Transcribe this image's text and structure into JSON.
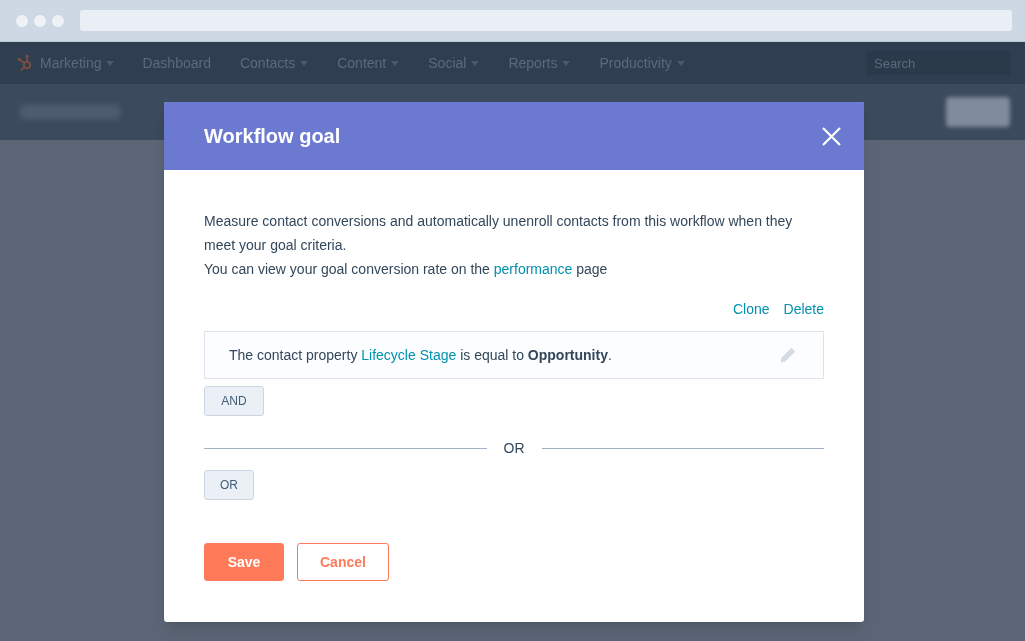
{
  "nav": {
    "app_menu": {
      "label": "Marketing",
      "has_menu": true
    },
    "items": [
      {
        "label": "Dashboard",
        "has_menu": false
      },
      {
        "label": "Contacts",
        "has_menu": true
      },
      {
        "label": "Content",
        "has_menu": true
      },
      {
        "label": "Social",
        "has_menu": true
      },
      {
        "label": "Reports",
        "has_menu": true
      },
      {
        "label": "Productivity",
        "has_menu": true
      }
    ],
    "search": {
      "placeholder": "Search"
    }
  },
  "modal": {
    "title": "Workflow goal",
    "description": "Measure contact conversions and automatically unenroll contacts from this workflow when they meet your goal criteria.",
    "note": {
      "before": "You can view your goal conversion rate on the",
      "link": "performance",
      "after": "page"
    },
    "actions": [
      "Clone",
      "Delete"
    ],
    "conditions": [
      {
        "before": "The contact property",
        "property": "Lifecycle Stage",
        "after": "is equal to **Opportunity**."
      }
    ],
    "and_button": "AND",
    "divider": "OR",
    "or_button": "OR",
    "buttons": [
      {
        "label": "Save",
        "kind": "primary"
      },
      {
        "label": "Cancel",
        "kind": "secondary"
      }
    ]
  }
}
